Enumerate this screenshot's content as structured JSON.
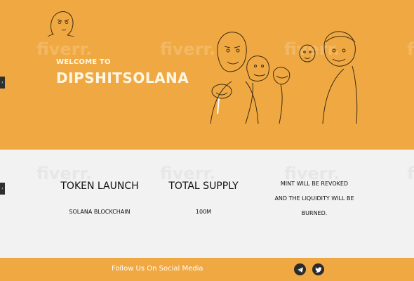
{
  "hero": {
    "welcome": "WELCOME TO",
    "title": "DIPSHITSOLANA"
  },
  "watermark": {
    "text": "fiverr."
  },
  "tokenomics": {
    "columns": [
      {
        "title": "TOKEN LAUNCH",
        "subtitle": "SOLANA BLOCKCHAIN"
      },
      {
        "title": "TOTAL SUPPLY",
        "subtitle": "100M"
      }
    ],
    "notice_lines": [
      "MINT WILL BE REVOKED",
      "AND THE LIQUIDITY WILL BE",
      "BURNED."
    ]
  },
  "footer": {
    "follow_label": "Follow Us On Social Media",
    "social": [
      {
        "icon": "telegram-icon"
      },
      {
        "icon": "twitter-icon"
      }
    ]
  },
  "colors": {
    "orange": "#f0a942",
    "light_gray": "#f2f2f2",
    "dark": "#2b2b2b",
    "white": "#ffffff"
  }
}
